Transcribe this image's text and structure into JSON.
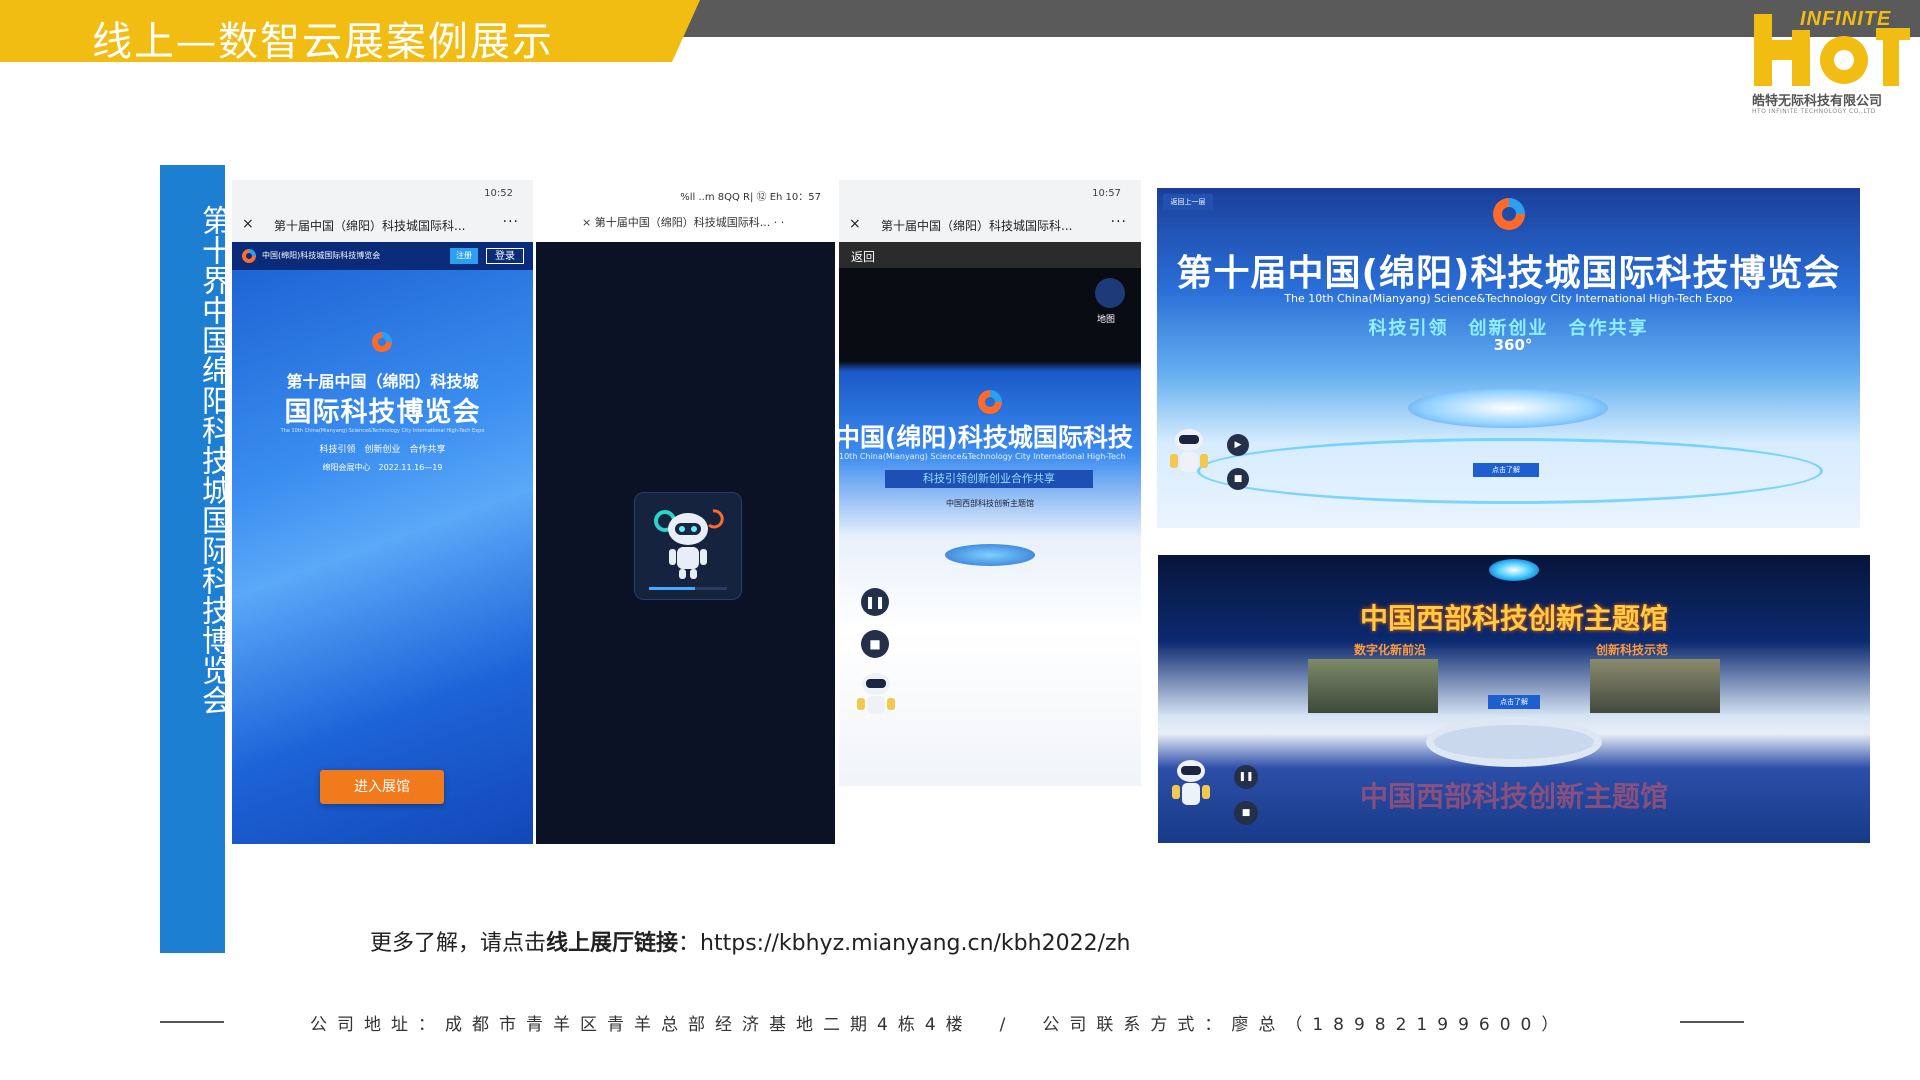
{
  "header": {
    "title": "线上—数智云展案例展示"
  },
  "logo": {
    "brand_small": "INFINITE",
    "company_cn": "皓特无际科技有限公司",
    "company_en": "HTO INFINITE TECHNOLOGY CO.,LTD"
  },
  "side_label": "第十界中国绵阳科技城国际科技博览会",
  "phone1": {
    "status_time": "10:52",
    "nav_title": "第十届中国（绵阳）科技城国际科...",
    "close": "×",
    "more": "···",
    "top_name": "中国(绵阳)科技城国际科技博览会",
    "btn_register": "注册",
    "btn_login": "登录",
    "headline_1": "第十届中国（绵阳）科技城",
    "headline_2": "国际科技博览会",
    "english": "The 10th China(Mianyang) Science&Technology City International High-Tech Expo",
    "slogan": "科技引领　创新创业　合作共享",
    "venue": "绵阳会展中心　2022.11.16—19",
    "enter_button": "进入展馆"
  },
  "phone2": {
    "status": "%ll ..m 8QQ R| ⑫ Eh 10：57",
    "nav_title": "× 第十届中国（绵阳）科技城国际科... · ·"
  },
  "phone3": {
    "status_time": "10:57",
    "nav_title": "第十届中国（绵阳）科技城国际科...",
    "close": "×",
    "more": "···",
    "back": "返回",
    "map_label": "地图",
    "title": "中国(绵阳)科技城国际科技",
    "english": "10th China(Mianyang) Science&Technology City International High-Tech",
    "slogan": "科技引领创新创业合作共享",
    "hall": "中国西部科技创新主题馆"
  },
  "pano1": {
    "title": "第十届中国(绵阳)科技城国际科技博览会",
    "english": "The 10th China(Mianyang) Science&Technology City International High-Tech Expo",
    "slogan": "科技引领　创新创业　合作共享",
    "badge": "360°",
    "back_label": "返回上一层",
    "button": "点击了解"
  },
  "pano2": {
    "title": "中国西部科技创新主题馆",
    "floor_text": "中国西部科技创新主题馆",
    "left_board": "数字化新前沿",
    "right_board": "创新科技示范",
    "button": "点击了解"
  },
  "link": {
    "prefix": "更多了解，请点击",
    "bold": "线上展厅链接",
    "colon": "：",
    "url": "https://kbhyz.mianyang.cn/kbh2022/zh"
  },
  "footer": {
    "text": "公司地址：成都市青羊区青羊总部经济基地二期4栋4楼　/　公司联系方式：廖总（18982199600）"
  },
  "colors": {
    "header_yellow": "#f2bd13",
    "header_gray": "#5a5a5a",
    "side_blue": "#1c7fd1",
    "enter_orange": "#f07a1c"
  }
}
